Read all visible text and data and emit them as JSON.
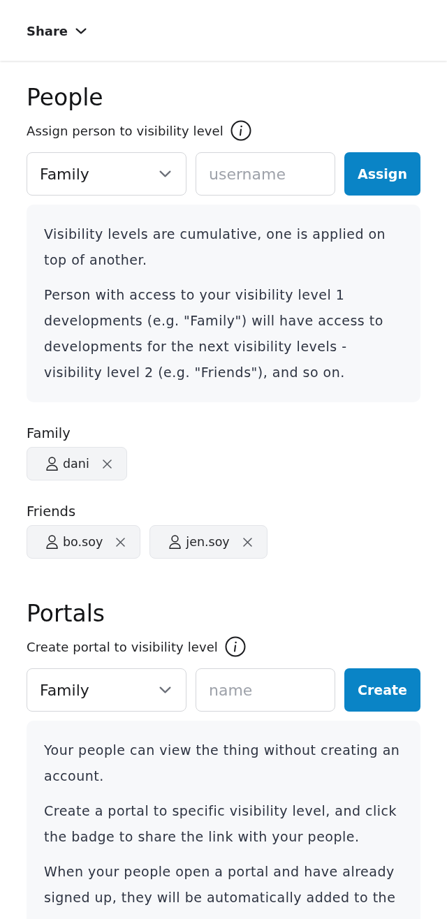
{
  "header": {
    "title": "Share"
  },
  "sections": [
    {
      "heading": "People",
      "form_label": "Assign person to visibility level",
      "select": {
        "value": "Family"
      },
      "input": {
        "placeholder": "username"
      },
      "button": "Assign",
      "info": [
        "Visibility levels are cumulative, one is applied on top of another.",
        "Person with access to your visibility level 1 developments (e.g. \"Family\") will have access to developments for the next visibility levels - visibility level 2 (e.g. \"Friends\"), and so on."
      ],
      "groups": [
        {
          "label": "Family",
          "members": [
            {
              "name": "dani"
            }
          ]
        },
        {
          "label": "Friends",
          "members": [
            {
              "name": "bo.soy"
            },
            {
              "name": "jen.soy"
            }
          ]
        }
      ]
    },
    {
      "heading": "Portals",
      "form_label": "Create portal to visibility level",
      "select": {
        "value": "Family"
      },
      "input": {
        "placeholder": "name"
      },
      "button": "Create",
      "info": [
        "Your people can view the thing without creating an account.",
        "Create a portal to specific visibility level, and click the badge to share the link with your people.",
        "When your people open a portal and have already signed up, they will be automatically added to the"
      ]
    }
  ]
}
